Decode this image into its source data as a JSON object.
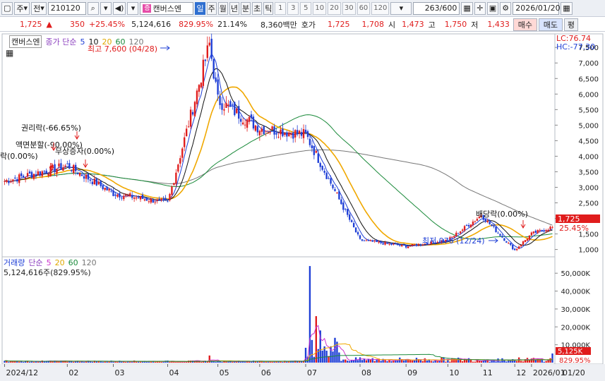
{
  "toolbar": {
    "dropdown1": "주",
    "dropdown2": "전",
    "code": "210120",
    "stock_name": "캔버스엔",
    "stock_icon": "증",
    "periods": [
      "일",
      "주",
      "월",
      "년",
      "분",
      "초",
      "틱"
    ],
    "active_period": "일",
    "nums": [
      "1",
      "3",
      "5",
      "10",
      "20",
      "30",
      "60",
      "120"
    ],
    "count": "263/600",
    "date": "2026/01/20"
  },
  "quote": {
    "price": "1,725",
    "arrow": "▲",
    "change": "350",
    "change_pct": "+25.45%",
    "volume": "5,124,616",
    "vol_ratio": "829.95%",
    "turnover": "21.14%",
    "amount": "8,360백만",
    "hoga_label": "호가",
    "ask": "1,725",
    "bid": "1,708",
    "open_label": "시",
    "open": "1,473",
    "high_label": "고",
    "high": "1,750",
    "low_label": "저",
    "low": "1,433",
    "buy_btn": "매수",
    "sell_btn": "매도",
    "eval_btn": "평"
  },
  "price_panel": {
    "name_tag": "캔버스엔",
    "legend_title": "종가 단순",
    "ma": [
      "5",
      "10",
      "20",
      "60",
      "120"
    ],
    "ma_colors": [
      "#1f3fd6",
      "#e01c1c",
      "#f0a800",
      "#1a8a3a",
      "#777777"
    ],
    "lc": "LC:76.74",
    "hc": "HC:-77.30",
    "y_ticks": [
      "7,500",
      "7,000",
      "6,500",
      "6,000",
      "5,500",
      "5,000",
      "4,500",
      "4,000",
      "3,500",
      "3,000",
      "2,500",
      "2,000",
      "1,500",
      "1,000"
    ],
    "last_price_tag": "1,725",
    "last_pct": "25.45%",
    "annotations": {
      "high": "최고 7,600 (04/28)",
      "low": "최저 976 (12/24)",
      "rights": "권리락(-66.65%)",
      "split": "액면분할(-90.00%)",
      "rights2": "무상증자(0.00%)",
      "left": "락(0.00%)",
      "dividend": "배당락(0.00%)"
    }
  },
  "volume_panel": {
    "legend_title": "거래량",
    "legend_sub": "단순",
    "ma": [
      "5",
      "20",
      "60",
      "120"
    ],
    "ma_colors": [
      "#cc33cc",
      "#f0a800",
      "#1a8a3a",
      "#777777"
    ],
    "summary": "5,124,616주(829.95%)",
    "y_ticks": [
      "50,000K",
      "40,000K",
      "30,000K",
      "20,000K",
      "10,000K"
    ],
    "last_tag": "5,125K",
    "last_pct": "829.95%"
  },
  "x_axis": {
    "labels": [
      "2024/12",
      "02",
      "03",
      "04",
      "05",
      "06",
      "07",
      "08",
      "09",
      "10",
      "11",
      "12",
      "2026/01",
      "01/20"
    ]
  },
  "chart_data": {
    "type": "candlestick",
    "price_range": [
      900,
      7800
    ],
    "volume_range": [
      0,
      56000
    ],
    "key_points": [
      {
        "label": "2024/12",
        "close": 3200
      },
      {
        "label": "02",
        "close": 3700
      },
      {
        "label": "03",
        "close": 2800
      },
      {
        "label": "04",
        "close": 2500
      },
      {
        "label": "04/28 high",
        "close": 7600
      },
      {
        "label": "05",
        "close": 5800
      },
      {
        "label": "06",
        "close": 4900
      },
      {
        "label": "07",
        "close": 4700
      },
      {
        "label": "08",
        "close": 1300
      },
      {
        "label": "09",
        "close": 1100
      },
      {
        "label": "10",
        "close": 1300
      },
      {
        "label": "11",
        "close": 2100
      },
      {
        "label": "12/24 low",
        "close": 976
      },
      {
        "label": "2026/01",
        "close": 1500
      },
      {
        "label": "01/20",
        "close": 1725
      }
    ]
  }
}
